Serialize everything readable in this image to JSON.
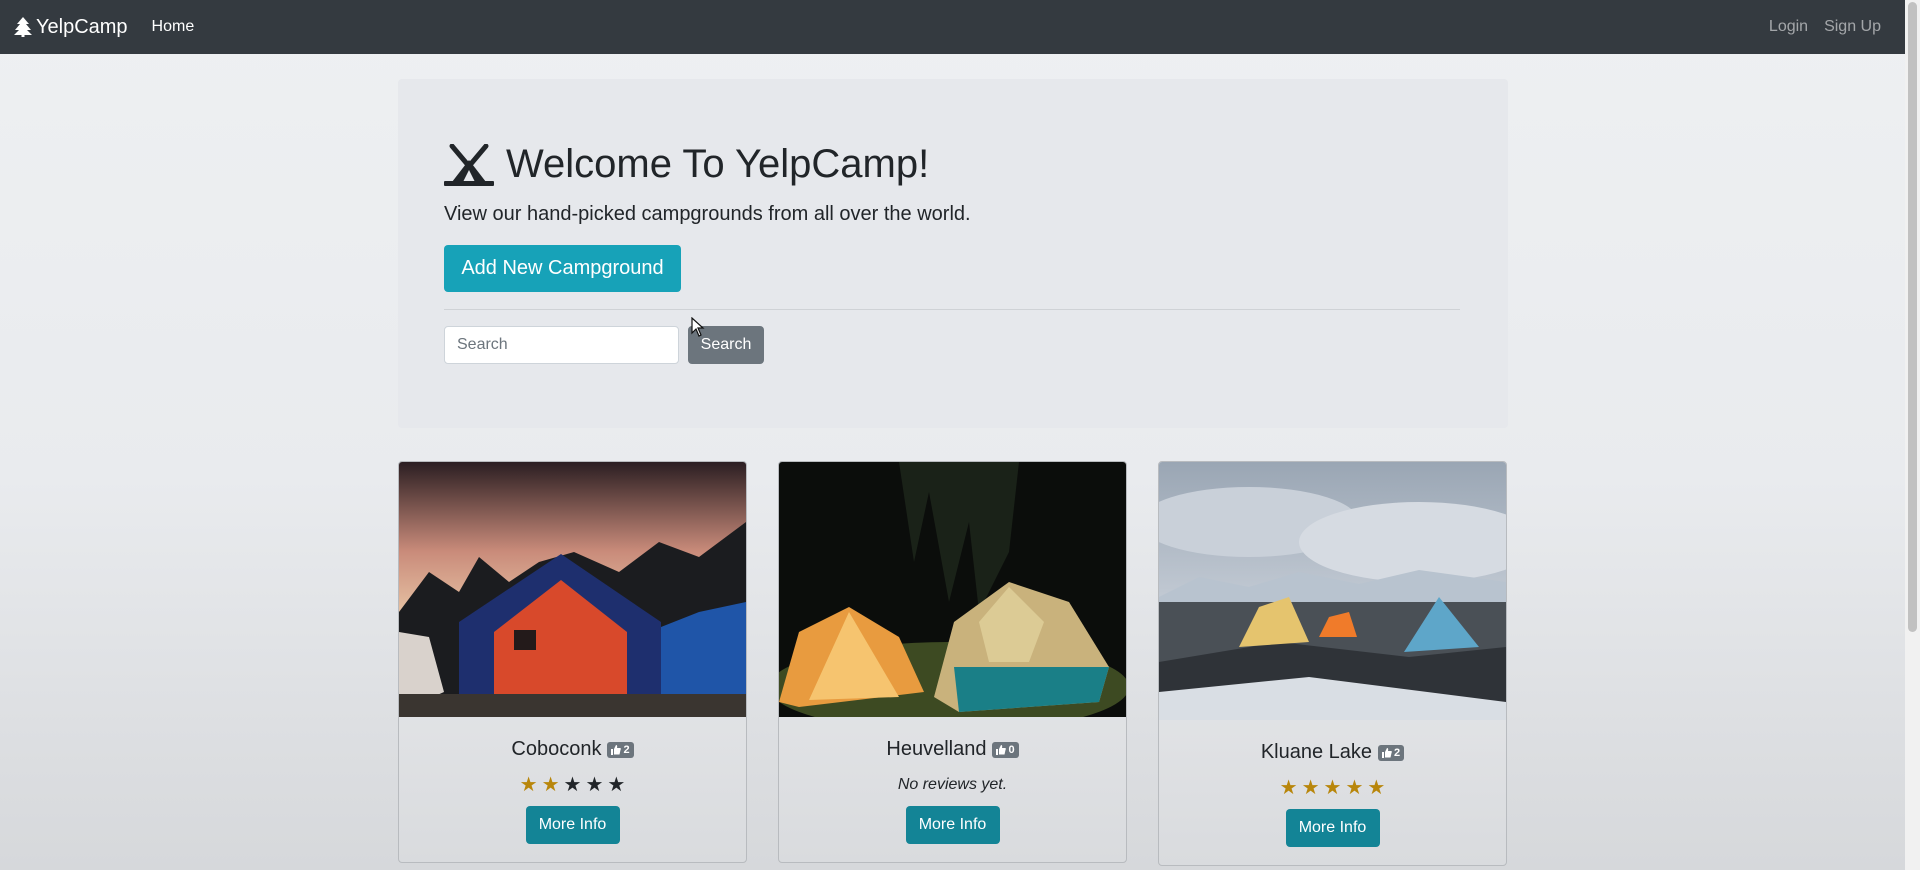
{
  "navbar": {
    "brand": "YelpCamp",
    "brand_icon": "tree-icon",
    "home": "Home",
    "login": "Login",
    "signup": "Sign Up"
  },
  "jumbotron": {
    "title": "Welcome To YelpCamp!",
    "title_icon": "campground-icon",
    "lead": "View our hand-picked campgrounds from all over the world.",
    "add_button": "Add New Campground",
    "search_placeholder": "Search",
    "search_value": "",
    "search_button": "Search"
  },
  "colors": {
    "navbar": "#343a40",
    "info": "#17a2b8",
    "secondary": "#6c757d",
    "star": "#b8860b"
  },
  "campgrounds": [
    {
      "name": "Coboconk",
      "likes": "2",
      "rating": 2,
      "reviews_text": "",
      "more_info": "More Info"
    },
    {
      "name": "Heuvelland",
      "likes": "0",
      "rating": 0,
      "reviews_text": "No reviews yet.",
      "more_info": "More Info"
    },
    {
      "name": "Kluane Lake",
      "likes": "2",
      "rating": 5,
      "reviews_text": "",
      "more_info": "More Info"
    }
  ]
}
